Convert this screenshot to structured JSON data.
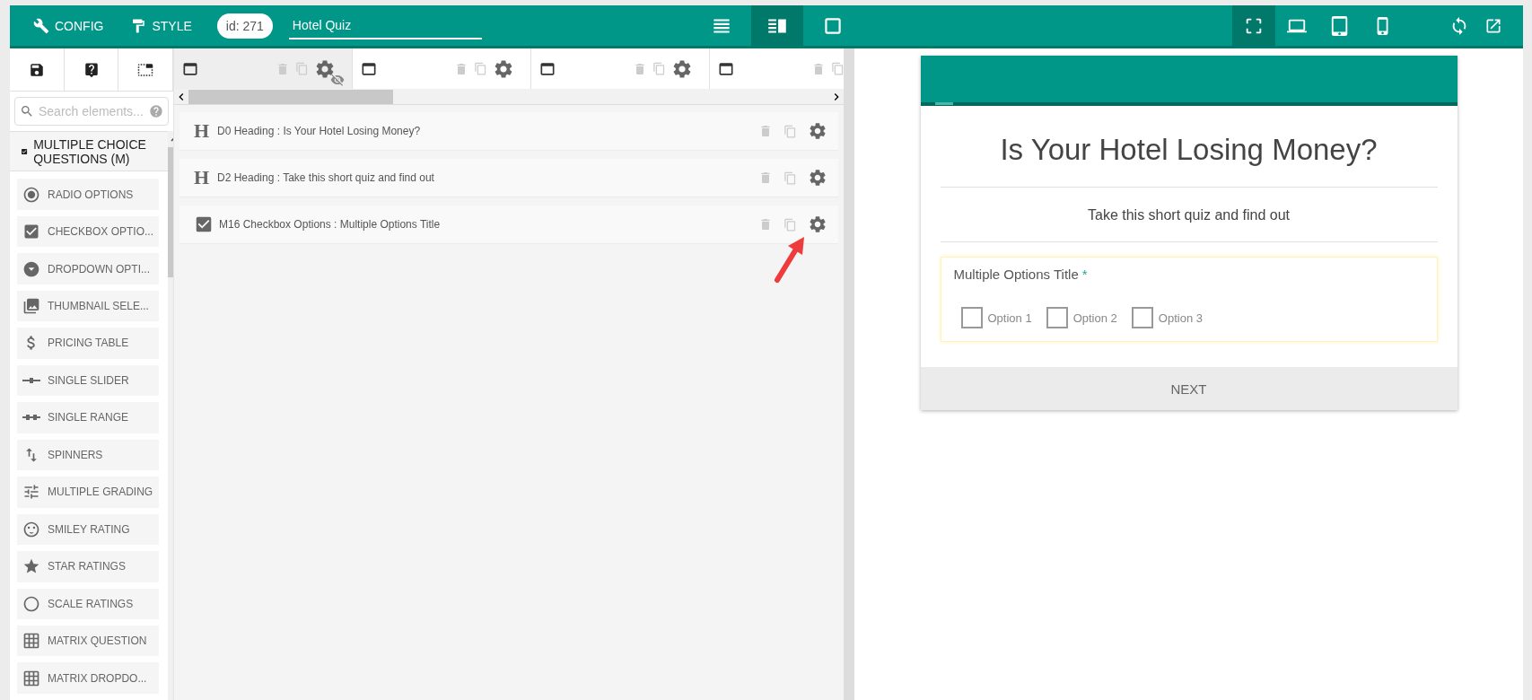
{
  "topbar": {
    "menu": [
      {
        "label": "CONFIG"
      },
      {
        "label": "STYLE"
      }
    ],
    "id_badge": "id: 271",
    "form_name": "Hotel Quiz",
    "layouts": [
      {
        "selected": false
      },
      {
        "selected": true
      },
      {
        "selected": false
      }
    ],
    "devices": [
      {
        "selected": true
      },
      {
        "selected": false
      },
      {
        "selected": false
      },
      {
        "selected": false
      }
    ]
  },
  "sidebar": {
    "tools": [
      {
        "selected": false
      },
      {
        "selected": false
      },
      {
        "selected": false
      }
    ],
    "search": {
      "placeholder": "Search elements..."
    },
    "category": {
      "label": "MULTIPLE CHOICE QUESTIONS (M)",
      "expanded": true
    },
    "items": [
      {
        "label": "RADIO OPTIONS"
      },
      {
        "label": "CHECKBOX OPTIO..."
      },
      {
        "label": "DROPDOWN OPTI..."
      },
      {
        "label": "THUMBNAIL SELE..."
      },
      {
        "label": "PRICING TABLE"
      },
      {
        "label": "SINGLE SLIDER"
      },
      {
        "label": "SINGLE RANGE"
      },
      {
        "label": "SPINNERS"
      },
      {
        "label": "MULTIPLE GRADING"
      },
      {
        "label": "SMILEY RATING"
      },
      {
        "label": "STAR RATINGS"
      },
      {
        "label": "SCALE RATINGS"
      },
      {
        "label": "MATRIX QUESTION"
      },
      {
        "label": "MATRIX DROPDO..."
      }
    ]
  },
  "pages": {
    "tabs": [
      {
        "selected": true,
        "hidden": true
      },
      {
        "selected": false,
        "hidden": false
      },
      {
        "selected": false,
        "hidden": false
      },
      {
        "selected": false,
        "hidden": false
      }
    ],
    "elements": [
      {
        "kind": "heading",
        "icon_letter": "H",
        "text": "D0 Heading : Is Your Hotel Losing Money?"
      },
      {
        "kind": "heading",
        "icon_letter": "H",
        "text": "D2 Heading : Take this short quiz and find out"
      },
      {
        "kind": "checkbox",
        "text": "M16 Checkbox Options : Multiple Options Title"
      }
    ]
  },
  "preview": {
    "title": "Is Your Hotel Losing Money?",
    "subtitle": "Take this short quiz and find out",
    "question": {
      "title": "Multiple Options Title",
      "required_mark": "*",
      "options": [
        {
          "label": "Option 1",
          "checked": false
        },
        {
          "label": "Option 2",
          "checked": false
        },
        {
          "label": "Option 3",
          "checked": false
        }
      ]
    },
    "next_button": "NEXT"
  }
}
